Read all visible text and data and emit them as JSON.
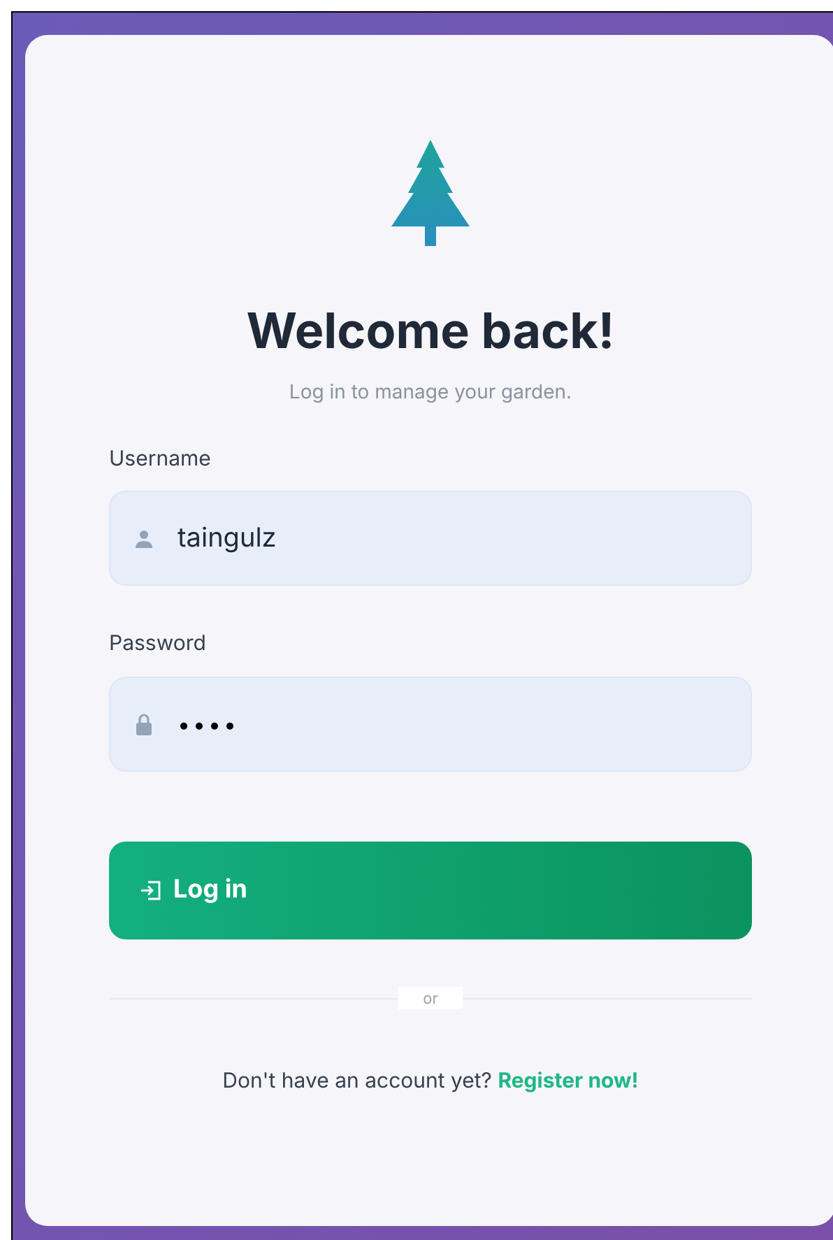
{
  "title": "Welcome back!",
  "subtitle": "Log in to manage your garden.",
  "fields": [
    {
      "kind": "text",
      "label": "Username",
      "value": "taingulz"
    },
    {
      "kind": "password",
      "label": "Password",
      "value": "••••"
    }
  ],
  "login_button": "Log in",
  "divider": "or",
  "footer": {
    "text": "Don't have an account yet?",
    "link": "Register now!"
  }
}
